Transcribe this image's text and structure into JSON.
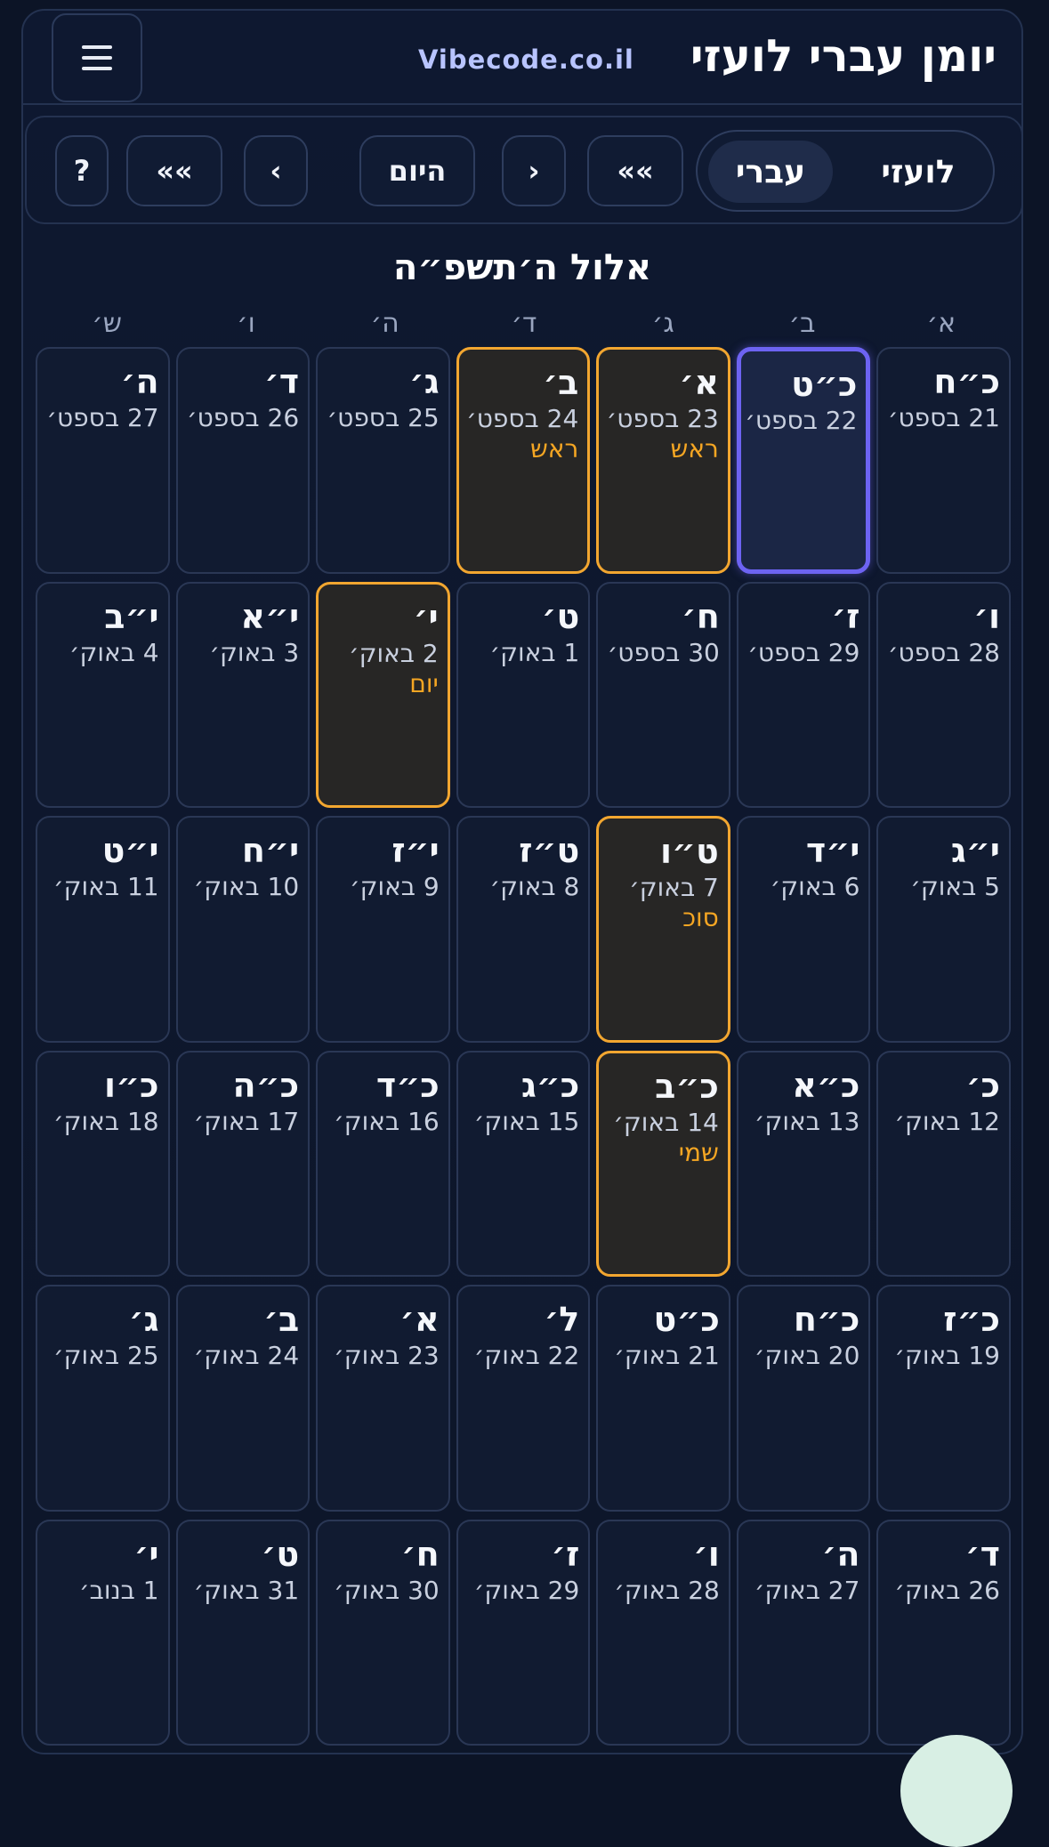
{
  "header": {
    "title": "יומן עברי לועזי",
    "site": "Vibecode.co.il",
    "menu_icon": "hamburger-menu-icon"
  },
  "toolbar": {
    "help": "?",
    "prev_year": "»»",
    "next": "›",
    "today": "היום",
    "prev": "‹",
    "next_year": "»»",
    "mode_hebrew": "עברי",
    "mode_gregorian": "לועזי",
    "active_mode": "עברי"
  },
  "month_title": "אלול ה׳תשפ״ה",
  "weekdays": [
    "א׳",
    "ב׳",
    "ג׳",
    "ד׳",
    "ה׳",
    "ו׳",
    "ש׳"
  ],
  "days": [
    {
      "heb": "כ״ח",
      "greg": "21 בספט׳",
      "hol": "",
      "kind": ""
    },
    {
      "heb": "כ״ט",
      "greg": "22 בספט׳",
      "hol": "",
      "kind": "today"
    },
    {
      "heb": "א׳",
      "greg": "23 בספט׳",
      "hol": "ראש",
      "kind": "holiday"
    },
    {
      "heb": "ב׳",
      "greg": "24 בספט׳",
      "hol": "ראש",
      "kind": "holiday"
    },
    {
      "heb": "ג׳",
      "greg": "25 בספט׳",
      "hol": "",
      "kind": ""
    },
    {
      "heb": "ד׳",
      "greg": "26 בספט׳",
      "hol": "",
      "kind": ""
    },
    {
      "heb": "ה׳",
      "greg": "27 בספט׳",
      "hol": "",
      "kind": ""
    },
    {
      "heb": "ו׳",
      "greg": "28 בספט׳",
      "hol": "",
      "kind": ""
    },
    {
      "heb": "ז׳",
      "greg": "29 בספט׳",
      "hol": "",
      "kind": ""
    },
    {
      "heb": "ח׳",
      "greg": "30 בספט׳",
      "hol": "",
      "kind": ""
    },
    {
      "heb": "ט׳",
      "greg": "1 באוק׳",
      "hol": "",
      "kind": ""
    },
    {
      "heb": "י׳",
      "greg": "2 באוק׳",
      "hol": "יום",
      "kind": "holiday"
    },
    {
      "heb": "י״א",
      "greg": "3 באוק׳",
      "hol": "",
      "kind": ""
    },
    {
      "heb": "י״ב",
      "greg": "4 באוק׳",
      "hol": "",
      "kind": ""
    },
    {
      "heb": "י״ג",
      "greg": "5 באוק׳",
      "hol": "",
      "kind": ""
    },
    {
      "heb": "י״ד",
      "greg": "6 באוק׳",
      "hol": "",
      "kind": ""
    },
    {
      "heb": "ט״ו",
      "greg": "7 באוק׳",
      "hol": "סוכ",
      "kind": "holiday"
    },
    {
      "heb": "ט״ז",
      "greg": "8 באוק׳",
      "hol": "",
      "kind": ""
    },
    {
      "heb": "י״ז",
      "greg": "9 באוק׳",
      "hol": "",
      "kind": ""
    },
    {
      "heb": "י״ח",
      "greg": "10 באוק׳",
      "hol": "",
      "kind": ""
    },
    {
      "heb": "י״ט",
      "greg": "11 באוק׳",
      "hol": "",
      "kind": ""
    },
    {
      "heb": "כ׳",
      "greg": "12 באוק׳",
      "hol": "",
      "kind": ""
    },
    {
      "heb": "כ״א",
      "greg": "13 באוק׳",
      "hol": "",
      "kind": ""
    },
    {
      "heb": "כ״ב",
      "greg": "14 באוק׳",
      "hol": "שמי",
      "kind": "holiday"
    },
    {
      "heb": "כ״ג",
      "greg": "15 באוק׳",
      "hol": "",
      "kind": ""
    },
    {
      "heb": "כ״ד",
      "greg": "16 באוק׳",
      "hol": "",
      "kind": ""
    },
    {
      "heb": "כ״ה",
      "greg": "17 באוק׳",
      "hol": "",
      "kind": ""
    },
    {
      "heb": "כ״ו",
      "greg": "18 באוק׳",
      "hol": "",
      "kind": ""
    },
    {
      "heb": "כ״ז",
      "greg": "19 באוק׳",
      "hol": "",
      "kind": ""
    },
    {
      "heb": "כ״ח",
      "greg": "20 באוק׳",
      "hol": "",
      "kind": ""
    },
    {
      "heb": "כ״ט",
      "greg": "21 באוק׳",
      "hol": "",
      "kind": ""
    },
    {
      "heb": "ל׳",
      "greg": "22 באוק׳",
      "hol": "",
      "kind": ""
    },
    {
      "heb": "א׳",
      "greg": "23 באוק׳",
      "hol": "",
      "kind": ""
    },
    {
      "heb": "ב׳",
      "greg": "24 באוק׳",
      "hol": "",
      "kind": ""
    },
    {
      "heb": "ג׳",
      "greg": "25 באוק׳",
      "hol": "",
      "kind": ""
    },
    {
      "heb": "ד׳",
      "greg": "26 באוק׳",
      "hol": "",
      "kind": ""
    },
    {
      "heb": "ה׳",
      "greg": "27 באוק׳",
      "hol": "",
      "kind": ""
    },
    {
      "heb": "ו׳",
      "greg": "28 באוק׳",
      "hol": "",
      "kind": ""
    },
    {
      "heb": "ז׳",
      "greg": "29 באוק׳",
      "hol": "",
      "kind": ""
    },
    {
      "heb": "ח׳",
      "greg": "30 באוק׳",
      "hol": "",
      "kind": ""
    },
    {
      "heb": "ט׳",
      "greg": "31 באוק׳",
      "hol": "",
      "kind": ""
    },
    {
      "heb": "י׳",
      "greg": "1 בנוב׳",
      "hol": "",
      "kind": ""
    }
  ],
  "colors": {
    "background": "#0c1426",
    "holiday_border": "#f2a630",
    "holiday_text": "#f5a623",
    "today_border": "#6d63f2",
    "site_text": "#b8c4ff"
  }
}
